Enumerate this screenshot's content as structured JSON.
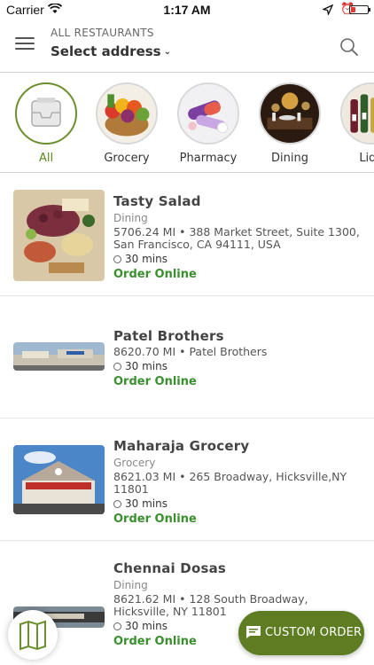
{
  "status_bar": {
    "carrier": "Carrier",
    "time": "1:17 AM"
  },
  "header": {
    "caption": "ALL RESTAURANTS",
    "address_label": "Select address"
  },
  "categories": [
    {
      "label": "All",
      "active": true
    },
    {
      "label": "Grocery"
    },
    {
      "label": "Pharmacy"
    },
    {
      "label": "Dining"
    },
    {
      "label": "Liqu"
    }
  ],
  "restaurants": [
    {
      "name": "Tasty Salad",
      "type": "Dining",
      "address": "5706.24 MI • 388 Market Street, Suite 1300, San Francisco, CA 94111, USA",
      "time": "30 mins",
      "order": "Order Online"
    },
    {
      "name": "Patel Brothers",
      "type": "",
      "address": "8620.70 MI • Patel Brothers",
      "time": "30 mins",
      "order": "Order Online"
    },
    {
      "name": "Maharaja Grocery",
      "type": "Grocery",
      "address": "8621.03 MI • 265 Broadway, Hicksville,NY 11801",
      "time": "30 mins",
      "order": "Order Online"
    },
    {
      "name": "Chennai Dosas",
      "type": "Dining",
      "address": "8621.62 MI • 128 South Broadway, Hicksville, NY 11801",
      "time": "30 mins",
      "order": "Order Online"
    }
  ],
  "custom_order_label": "CUSTOM ORDER",
  "colors": {
    "accent": "#5e7d23",
    "link_green": "#3a8f2e",
    "battery_low": "#e53935"
  }
}
